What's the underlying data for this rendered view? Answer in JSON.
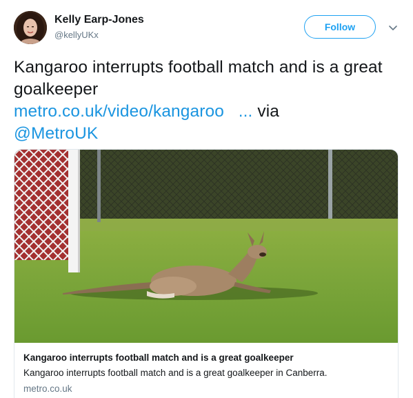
{
  "user": {
    "display_name": "Kelly Earp-Jones",
    "handle": "@kellyUKx"
  },
  "actions": {
    "follow_label": "Follow"
  },
  "tweet": {
    "text_line": "Kangaroo interrupts football match and is a great goalkeeper",
    "link_text": "metro.co.uk/video/kangaroo",
    "link_ellipsis": "...",
    "via_text": "via",
    "mention": "@MetroUK"
  },
  "card": {
    "title": "Kangaroo interrupts football match and is a great goalkeeper",
    "description": "Kangaroo interrupts football match and is a great goalkeeper in Canberra.",
    "domain": "metro.co.uk"
  },
  "colors": {
    "accent": "#1da1f2",
    "link": "#1b95e0",
    "muted": "#657786",
    "text": "#14171a"
  },
  "icons": {
    "caret": "chevron-down-icon"
  }
}
